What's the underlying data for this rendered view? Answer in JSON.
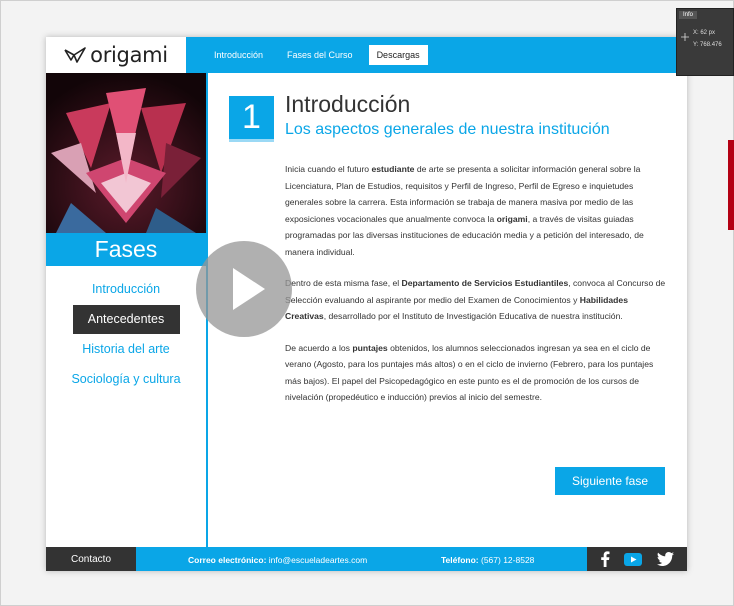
{
  "header": {
    "logo_text": "origami",
    "nav": [
      {
        "label": "Introducción"
      },
      {
        "label": "Fases del Curso"
      },
      {
        "label": "Descargas"
      }
    ]
  },
  "sidebar": {
    "heading": "Fases",
    "items": [
      {
        "label": "Introducción"
      },
      {
        "label": "Antecedentes"
      },
      {
        "label": "Historia del arte"
      },
      {
        "label": "Sociología y cultura"
      }
    ],
    "active_index": 1
  },
  "content": {
    "number": "1",
    "title": "Introducción",
    "subtitle": "Los aspectos generales de nuestra institución",
    "paragraphs": [
      "Inicia cuando el futuro <b>estudiante</b> de arte se presenta a solicitar información general sobre la Licenciatura, Plan de Estudios, requisitos y Perfil de Ingreso, Perfil de Egreso e inquietudes generales sobre la carrera. Esta información se trabaja de manera masiva por medio de las exposiciones vocacionales que anualmente convoca la <b>origami</b>, a través de visitas guiadas programadas por las diversas instituciones de educación media y a petición del interesado, de manera individual.",
      "Dentro de esta misma fase, el <b>Departamento de Servicios Estudiantiles</b>, convoca al Concurso de Selección evaluando al aspirante por medio del Examen de Conocimientos y <b>Habilidades Creativas</b>, desarrollado por el Instituto de Investigación Educativa de nuestra institución.",
      "De acuerdo a los <b>puntajes</b> obtenidos, los alumnos seleccionados ingresan ya sea en el ciclo de verano (Agosto, para los puntajes más altos) o en el ciclo de invierno (Febrero, para los puntajes más bajos). El papel del Psicopedagógico en este punto es el de promoción de los cursos de nivelación (propedéutico e inducción) previos al inicio del semestre."
    ],
    "next_button": "Siguiente fase"
  },
  "footer": {
    "contact_label": "Contacto",
    "email_label": "Correo electrónico:",
    "email_value": "info@escueladeartes.com",
    "phone_label": "Teléfono:",
    "phone_value": "(567) 12-8528",
    "social_icons": [
      "facebook-icon",
      "youtube-icon",
      "twitter-icon"
    ]
  },
  "info_panel": {
    "tab": "Info",
    "x_label": "X:",
    "x_value": "62 px",
    "y_label": "Y:",
    "y_value": "768.476"
  },
  "colors": {
    "accent": "#0aa6e7",
    "dark": "#333333"
  }
}
